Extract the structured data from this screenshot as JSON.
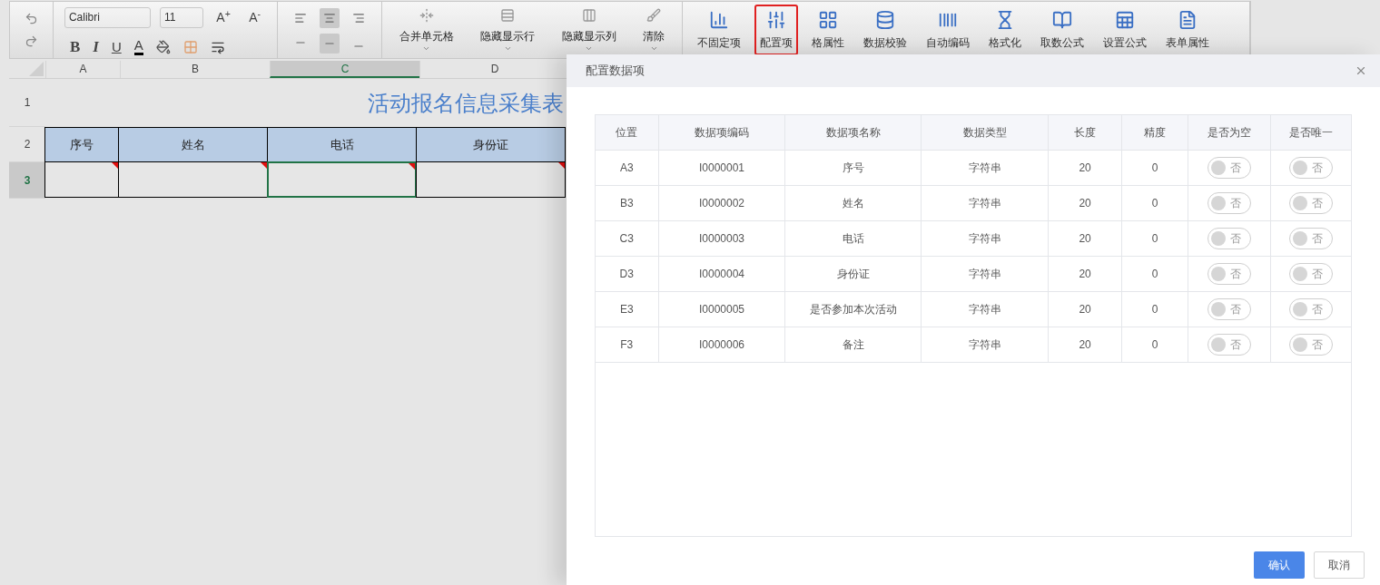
{
  "toolbar": {
    "font": {
      "name": "Calibri",
      "size": "11"
    },
    "font_size_buttons": [
      "A$^{+}$",
      "A$^{-}$"
    ],
    "style_buttons": [
      {
        "kind": "bold",
        "label": "B"
      },
      {
        "kind": "italic",
        "label": "I"
      },
      {
        "kind": "underline",
        "label": "U"
      },
      {
        "kind": "color",
        "label": "A"
      }
    ],
    "horizontal_align": [
      {
        "kind": "left",
        "selected": false
      },
      {
        "kind": "center",
        "selected": true
      },
      {
        "kind": "right",
        "selected": false
      }
    ],
    "vertical_align": [
      {
        "kind": "top",
        "selected": false
      },
      {
        "kind": "middle",
        "selected": true
      },
      {
        "kind": "bottom",
        "selected": false
      }
    ],
    "cell_tools": [
      {
        "label": "合并单元格"
      },
      {
        "label": "隐藏显示行"
      },
      {
        "label": "隐藏显示列"
      },
      {
        "label": "清除"
      }
    ],
    "data_tools": [
      {
        "label": "不固定项",
        "selected": false
      },
      {
        "label": "配置项",
        "selected": true
      },
      {
        "label": "格属性",
        "selected": false
      },
      {
        "label": "数据校验",
        "selected": false
      },
      {
        "label": "自动编码",
        "selected": false
      },
      {
        "label": "格式化",
        "selected": false
      },
      {
        "label": "取数公式",
        "selected": false
      },
      {
        "label": "设置公式",
        "selected": false
      },
      {
        "label": "表单属性",
        "selected": false
      }
    ]
  },
  "sheet": {
    "columns": [
      {
        "label": "A",
        "selected": false
      },
      {
        "label": "B",
        "selected": false
      },
      {
        "label": "C",
        "selected": true
      },
      {
        "label": "D",
        "selected": false
      }
    ],
    "rows": [
      {
        "label": "1",
        "selected": false
      },
      {
        "label": "2",
        "selected": false
      },
      {
        "label": "3",
        "selected": true
      }
    ],
    "title": "活动报名信息采集表",
    "header_cells": [
      "序号",
      "姓名",
      "电话",
      "身份证"
    ],
    "input_cells": [
      {
        "has_note": true,
        "selected": false
      },
      {
        "has_note": true,
        "selected": false
      },
      {
        "has_note": true,
        "selected": true
      },
      {
        "has_note": true,
        "selected": false
      }
    ]
  },
  "dialog": {
    "title": "配置数据项",
    "columns": [
      "位置",
      "数据项编码",
      "数据项名称",
      "数据类型",
      "长度",
      "精度",
      "是否为空",
      "是否唯一"
    ],
    "rows": [
      {
        "position": "A3",
        "code": "I0000001",
        "name": "序号",
        "type": "字符串",
        "length": "20",
        "precision": "0",
        "nullable": {
          "checked": false,
          "label": "否"
        },
        "unique": {
          "checked": false,
          "label": "否"
        }
      },
      {
        "position": "B3",
        "code": "I0000002",
        "name": "姓名",
        "type": "字符串",
        "length": "20",
        "precision": "0",
        "nullable": {
          "checked": false,
          "label": "否"
        },
        "unique": {
          "checked": false,
          "label": "否"
        }
      },
      {
        "position": "C3",
        "code": "I0000003",
        "name": "电话",
        "type": "字符串",
        "length": "20",
        "precision": "0",
        "nullable": {
          "checked": false,
          "label": "否"
        },
        "unique": {
          "checked": false,
          "label": "否"
        }
      },
      {
        "position": "D3",
        "code": "I0000004",
        "name": "身份证",
        "type": "字符串",
        "length": "20",
        "precision": "0",
        "nullable": {
          "checked": false,
          "label": "否"
        },
        "unique": {
          "checked": false,
          "label": "否"
        }
      },
      {
        "position": "E3",
        "code": "I0000005",
        "name": "是否参加本次活动",
        "type": "字符串",
        "length": "20",
        "precision": "0",
        "nullable": {
          "checked": false,
          "label": "否"
        },
        "unique": {
          "checked": false,
          "label": "否"
        }
      },
      {
        "position": "F3",
        "code": "I0000006",
        "name": "备注",
        "type": "字符串",
        "length": "20",
        "precision": "0",
        "nullable": {
          "checked": false,
          "label": "否"
        },
        "unique": {
          "checked": false,
          "label": "否"
        }
      }
    ],
    "buttons": [
      {
        "kind": "primary",
        "label": "确认"
      },
      {
        "kind": "secondary",
        "label": "取消"
      }
    ]
  }
}
